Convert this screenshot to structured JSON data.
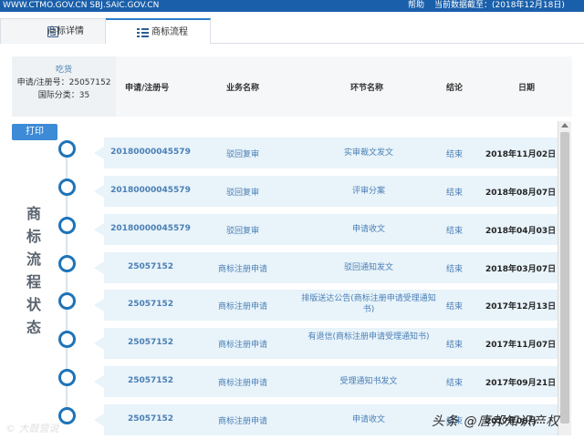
{
  "topbar": {
    "site": "WWW.CTMO.GOV.CN  SBJ.SAIC.GOV.CN",
    "help": "帮助",
    "date": "当前数据截至：(2018年12月18日)"
  },
  "tabs": [
    {
      "label": "商标详情",
      "icon": "document-icon"
    },
    {
      "label": "商标流程",
      "icon": "list-icon"
    }
  ],
  "info": {
    "name": "吃货",
    "reg_no": "申请/注册号：25057152",
    "intl_class": "国际分类：35"
  },
  "table": {
    "headers": [
      "申请/注册号",
      "业务名称",
      "环节名称",
      "结论",
      "日期"
    ],
    "rows": [
      {
        "reg_no": "20180000045579",
        "business": "驳回复审",
        "step": "实审裁文发文",
        "result": "结束",
        "date": "2018年11月02日"
      },
      {
        "reg_no": "20180000045579",
        "business": "驳回复审",
        "step": "评审分案",
        "result": "结束",
        "date": "2018年08月07日"
      },
      {
        "reg_no": "20180000045579",
        "business": "驳回复审",
        "step": "申请收文",
        "result": "结束",
        "date": "2018年04月03日"
      },
      {
        "reg_no": "25057152",
        "business": "商标注册申请",
        "step": "驳回通知发文",
        "result": "结束",
        "date": "2018年03月07日"
      },
      {
        "reg_no": "25057152",
        "business": "商标注册申请",
        "step": "排版送达公告(商标注册申请受理通知书)",
        "result": "结束",
        "date": "2017年12月13日"
      },
      {
        "reg_no": "25057152",
        "business": "商标注册申请",
        "step": "有退信(商标注册申请受理通知书)",
        "result": "结束",
        "date": "2017年11月07日"
      },
      {
        "reg_no": "25057152",
        "business": "商标注册申请",
        "step": "受理通知书发文",
        "result": "结束",
        "date": "2017年09月21日"
      },
      {
        "reg_no": "25057152",
        "business": "商标注册申请",
        "step": "申请收文",
        "result": "结束",
        "date": "2017年08月..."
      }
    ]
  },
  "print_button": "打印",
  "vertical_label": "商标流程状态",
  "watermark_left": "© 大鼓营说",
  "watermark_right": "头条 @唐邦知识产权"
}
